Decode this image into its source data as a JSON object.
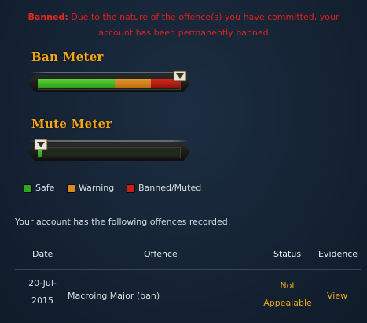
{
  "ban_notice": {
    "label": "Banned:",
    "line1": "Due to the nature of the offence(s) you have committed, your",
    "line2": "account has been permanently banned"
  },
  "ban_meter": {
    "title": "Ban Meter",
    "segments": [
      {
        "name": "Safe",
        "color": "#2fa81c",
        "fraction": 0.54
      },
      {
        "name": "Warning",
        "color": "#c77a16",
        "fraction": 0.25
      },
      {
        "name": "Banned/Muted",
        "color": "#b81a12",
        "fraction": 0.21
      }
    ],
    "level": 0.97
  },
  "mute_meter": {
    "title": "Mute Meter",
    "level": 0.03
  },
  "legend": [
    {
      "label": "Safe",
      "color": "#2fa81c"
    },
    {
      "label": "Warning",
      "color": "#d88a20"
    },
    {
      "label": "Banned/Muted",
      "color": "#c8201a"
    }
  ],
  "offences_intro": "Your account has the following offences recorded:",
  "table": {
    "headers": {
      "date": "Date",
      "offence": "Offence",
      "status": "Status",
      "evidence": "Evidence"
    },
    "rows": [
      {
        "date_line1": "20-Jul-",
        "date_line2": "2015",
        "offence": "Macroing Major (ban)",
        "status_line1": "Not",
        "status_line2": "Appealable",
        "evidence": "View"
      }
    ]
  },
  "colors": {
    "accent_gold": "#f0a81c",
    "alert_red": "#e0201b",
    "background": "#142231"
  }
}
